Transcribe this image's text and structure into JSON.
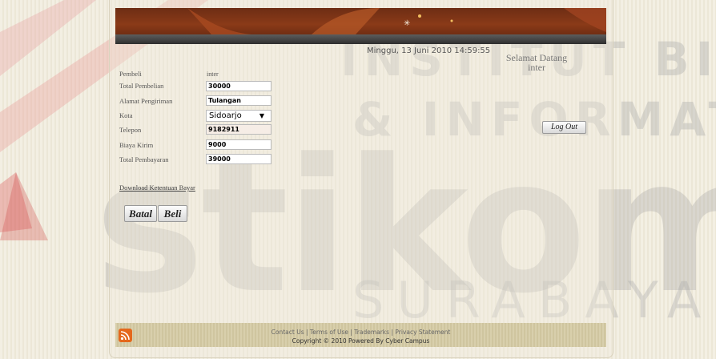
{
  "header": {
    "datetime": "Minggu, 13 Juni 2010 14:59:55",
    "welcome_line1": "Selamat Datang",
    "welcome_line2": "inter"
  },
  "form": {
    "pembeli_label": "Pembeli",
    "pembeli_value": "inter",
    "total_pembelian_label": "Total Pembelian",
    "total_pembelian_value": "30000",
    "alamat_label": "Alamat Pengiriman",
    "alamat_value": "Tulangan",
    "kota_label": "Kota",
    "kota_value": "Sidoarjo",
    "telepon_label": "Telepon",
    "telepon_value": "9182911",
    "biaya_label": "Biaya Kirim",
    "biaya_value": "9000",
    "total_bayar_label": "Total Pembayaran",
    "total_bayar_value": "39000"
  },
  "actions": {
    "download_link": "Download Ketentuan Bayar",
    "batal": "Batal",
    "beli": "Beli",
    "logout": "Log Out"
  },
  "footer": {
    "links": "Contact Us | Terms of Use | Trademarks | Privacy Statement",
    "copyright": "Copyright © 2010 Powered By Cyber Campus"
  },
  "watermark": {
    "line1": "INSTITUT BISNIS",
    "line2": "& INFORMATIKA",
    "line3": "stikom",
    "line4": "SURABAYA"
  },
  "colors": {
    "banner": "#7a3316",
    "footer": "#d8cfac",
    "logo_red": "#d8343a"
  }
}
